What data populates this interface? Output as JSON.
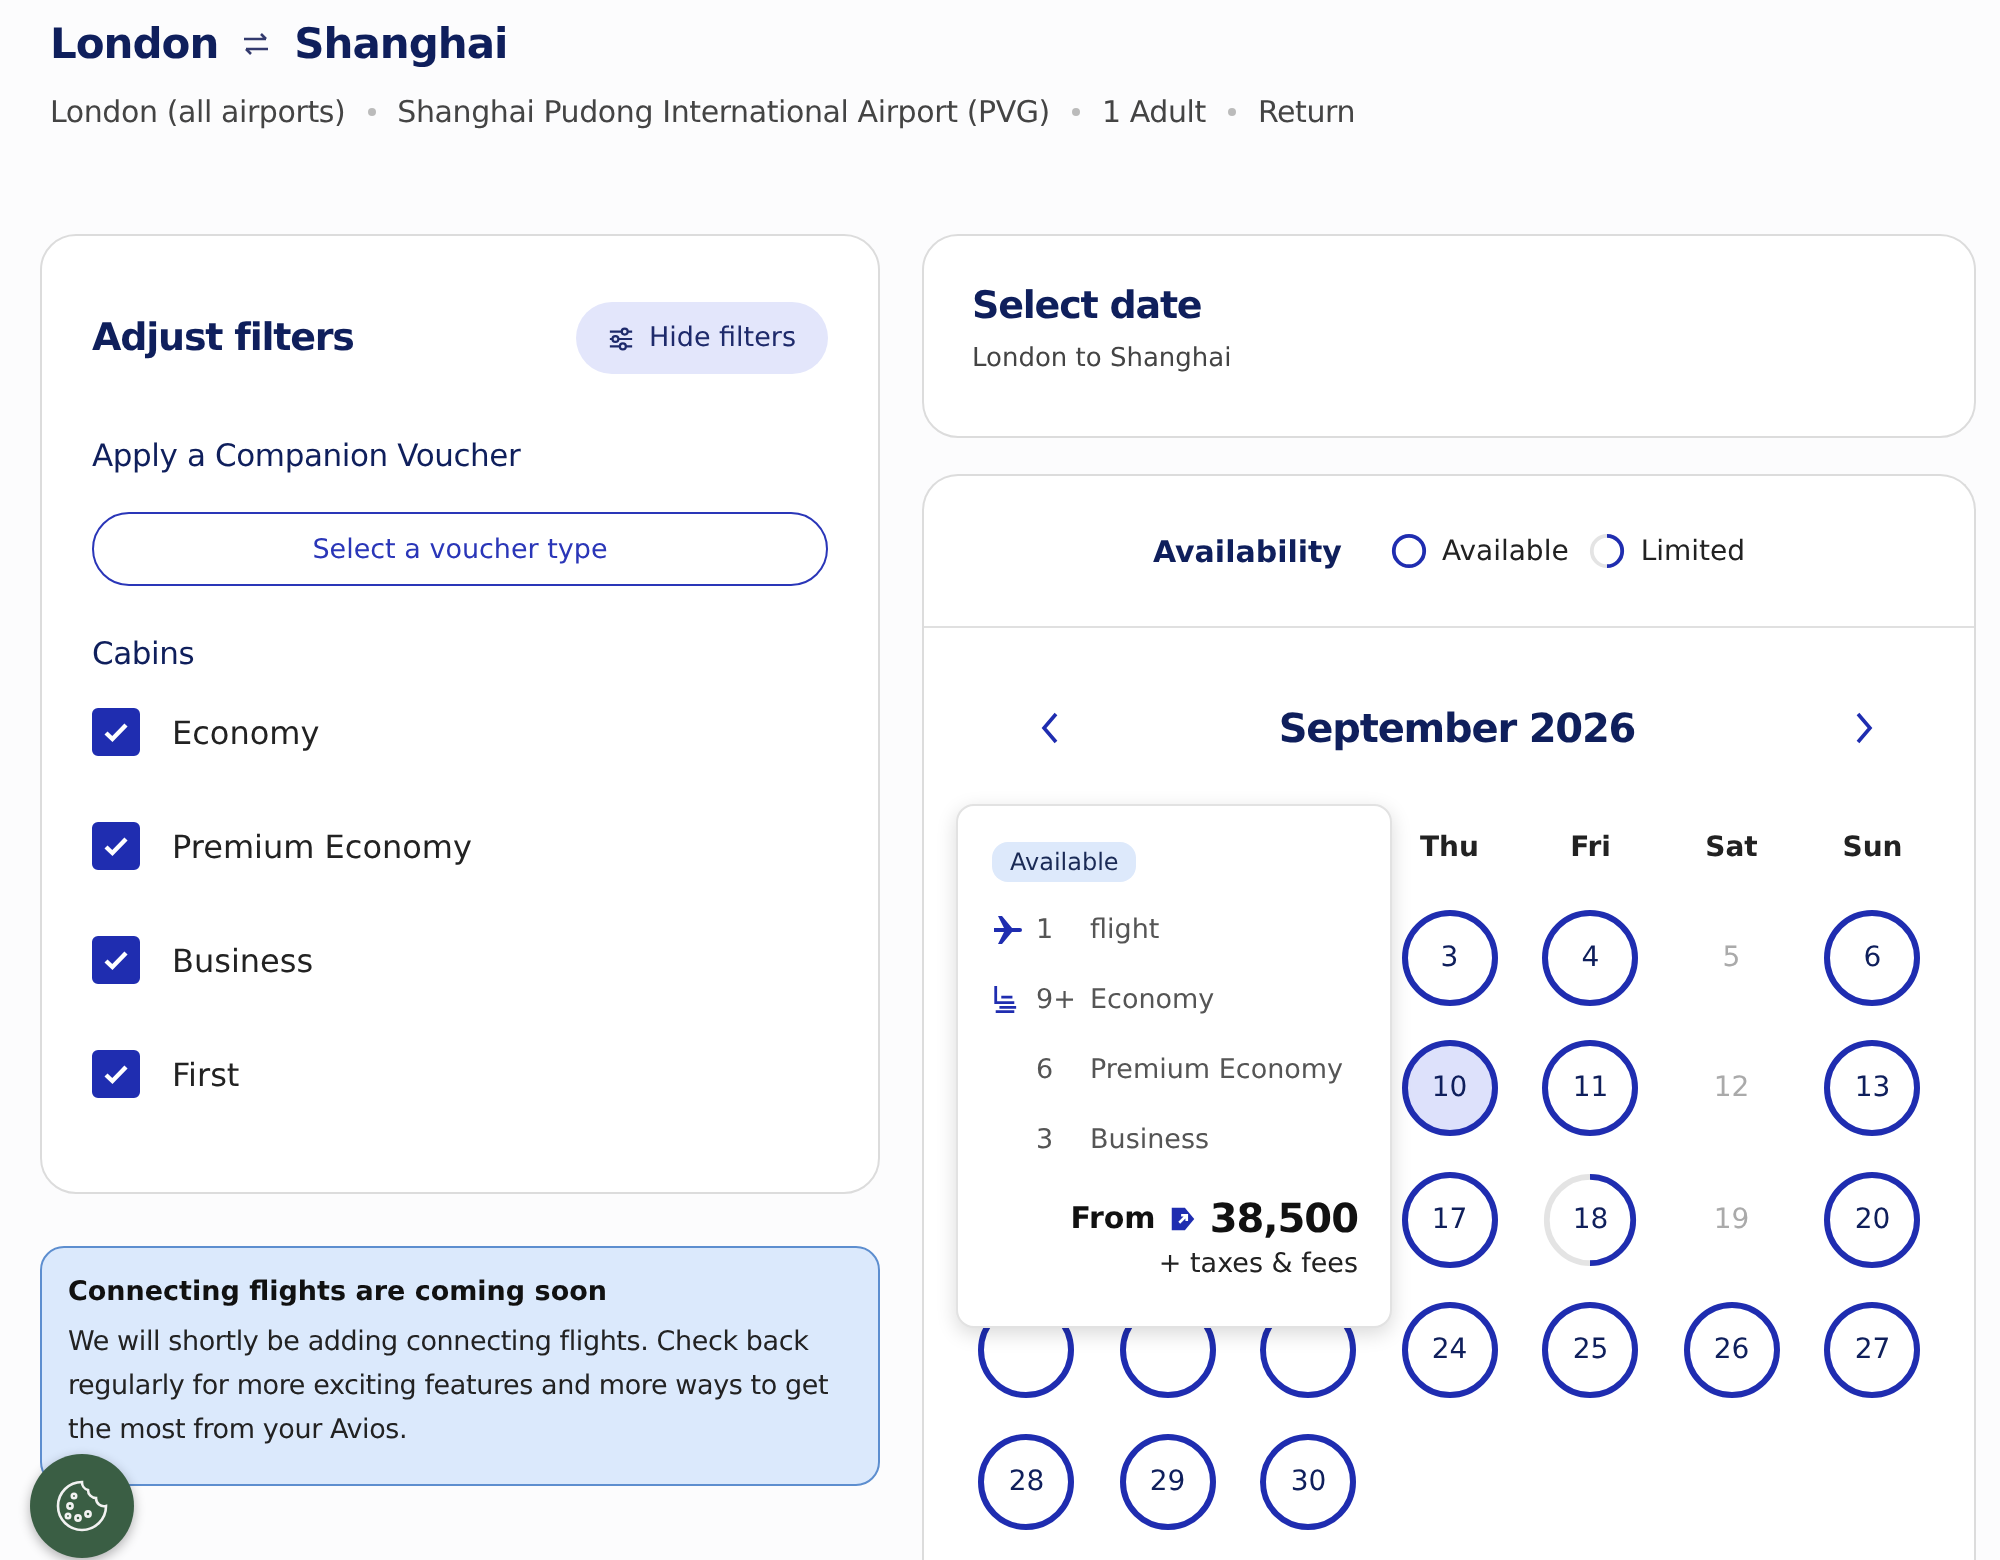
{
  "route": {
    "origin": "London",
    "destination": "Shanghai",
    "details": [
      "London (all airports)",
      "Shanghai Pudong International Airport (PVG)",
      "1 Adult",
      "Return"
    ]
  },
  "filters": {
    "title": "Adjust filters",
    "hide_button": "Hide filters",
    "voucher_label": "Apply a Companion Voucher",
    "voucher_button": "Select a voucher type",
    "cabins_label": "Cabins",
    "cabins": [
      {
        "label": "Economy",
        "checked": true
      },
      {
        "label": "Premium Economy",
        "checked": true
      },
      {
        "label": "Business",
        "checked": true
      },
      {
        "label": "First",
        "checked": true
      }
    ]
  },
  "notice": {
    "title": "Connecting flights are coming soon",
    "body": "We will shortly be adding connecting flights. Check back regularly for more exciting features and more ways to get the most from your Avios."
  },
  "date_panel": {
    "title": "Select date",
    "subtitle": "London to Shanghai"
  },
  "calendar": {
    "legend_title": "Availability",
    "legend": [
      {
        "label": "Available",
        "kind": "available"
      },
      {
        "label": "Limited",
        "kind": "limited"
      }
    ],
    "month": "September 2026",
    "weekdays": [
      "Thu",
      "Fri",
      "Sat",
      "Sun"
    ],
    "weeks": [
      [
        {
          "kind": "blank"
        },
        {
          "kind": "blank"
        },
        {
          "kind": "blank"
        },
        {
          "kind": "available",
          "day": "3",
          "selected": false
        },
        {
          "kind": "available",
          "day": "4",
          "selected": false
        },
        {
          "kind": "unavailable",
          "day": "5"
        },
        {
          "kind": "available",
          "day": "6",
          "selected": false
        }
      ],
      [
        {
          "kind": "blank"
        },
        {
          "kind": "blank"
        },
        {
          "kind": "blank"
        },
        {
          "kind": "available",
          "day": "10",
          "selected": true
        },
        {
          "kind": "available",
          "day": "11",
          "selected": false
        },
        {
          "kind": "unavailable",
          "day": "12"
        },
        {
          "kind": "available",
          "day": "13",
          "selected": false
        }
      ],
      [
        {
          "kind": "blank"
        },
        {
          "kind": "blank"
        },
        {
          "kind": "blank"
        },
        {
          "kind": "available",
          "day": "17",
          "selected": false
        },
        {
          "kind": "limited",
          "day": "18",
          "selected": false
        },
        {
          "kind": "unavailable",
          "day": "19"
        },
        {
          "kind": "available",
          "day": "20",
          "selected": false
        }
      ],
      [
        {
          "kind": "covered"
        },
        {
          "kind": "covered"
        },
        {
          "kind": "covered"
        },
        {
          "kind": "available",
          "day": "24",
          "selected": false
        },
        {
          "kind": "available",
          "day": "25",
          "selected": false
        },
        {
          "kind": "available",
          "day": "26",
          "selected": false
        },
        {
          "kind": "available",
          "day": "27",
          "selected": false
        }
      ],
      [
        {
          "kind": "available",
          "day": "28",
          "selected": false
        },
        {
          "kind": "available",
          "day": "29",
          "selected": false
        },
        {
          "kind": "available",
          "day": "30",
          "selected": false
        },
        {
          "kind": "blank"
        },
        {
          "kind": "blank"
        },
        {
          "kind": "blank"
        },
        {
          "kind": "blank"
        }
      ]
    ],
    "tooltip": {
      "badge": "Available",
      "rows": [
        {
          "kind": "flights",
          "count": "1",
          "label": "flight"
        },
        {
          "kind": "cabin_first",
          "count": "9+",
          "label": "Economy"
        },
        {
          "kind": "cabin",
          "count": "6",
          "label": "Premium Economy"
        },
        {
          "kind": "cabin",
          "count": "3",
          "label": "Business"
        }
      ],
      "from": "From",
      "price": "38,500",
      "note": "+ taxes & fees"
    }
  }
}
